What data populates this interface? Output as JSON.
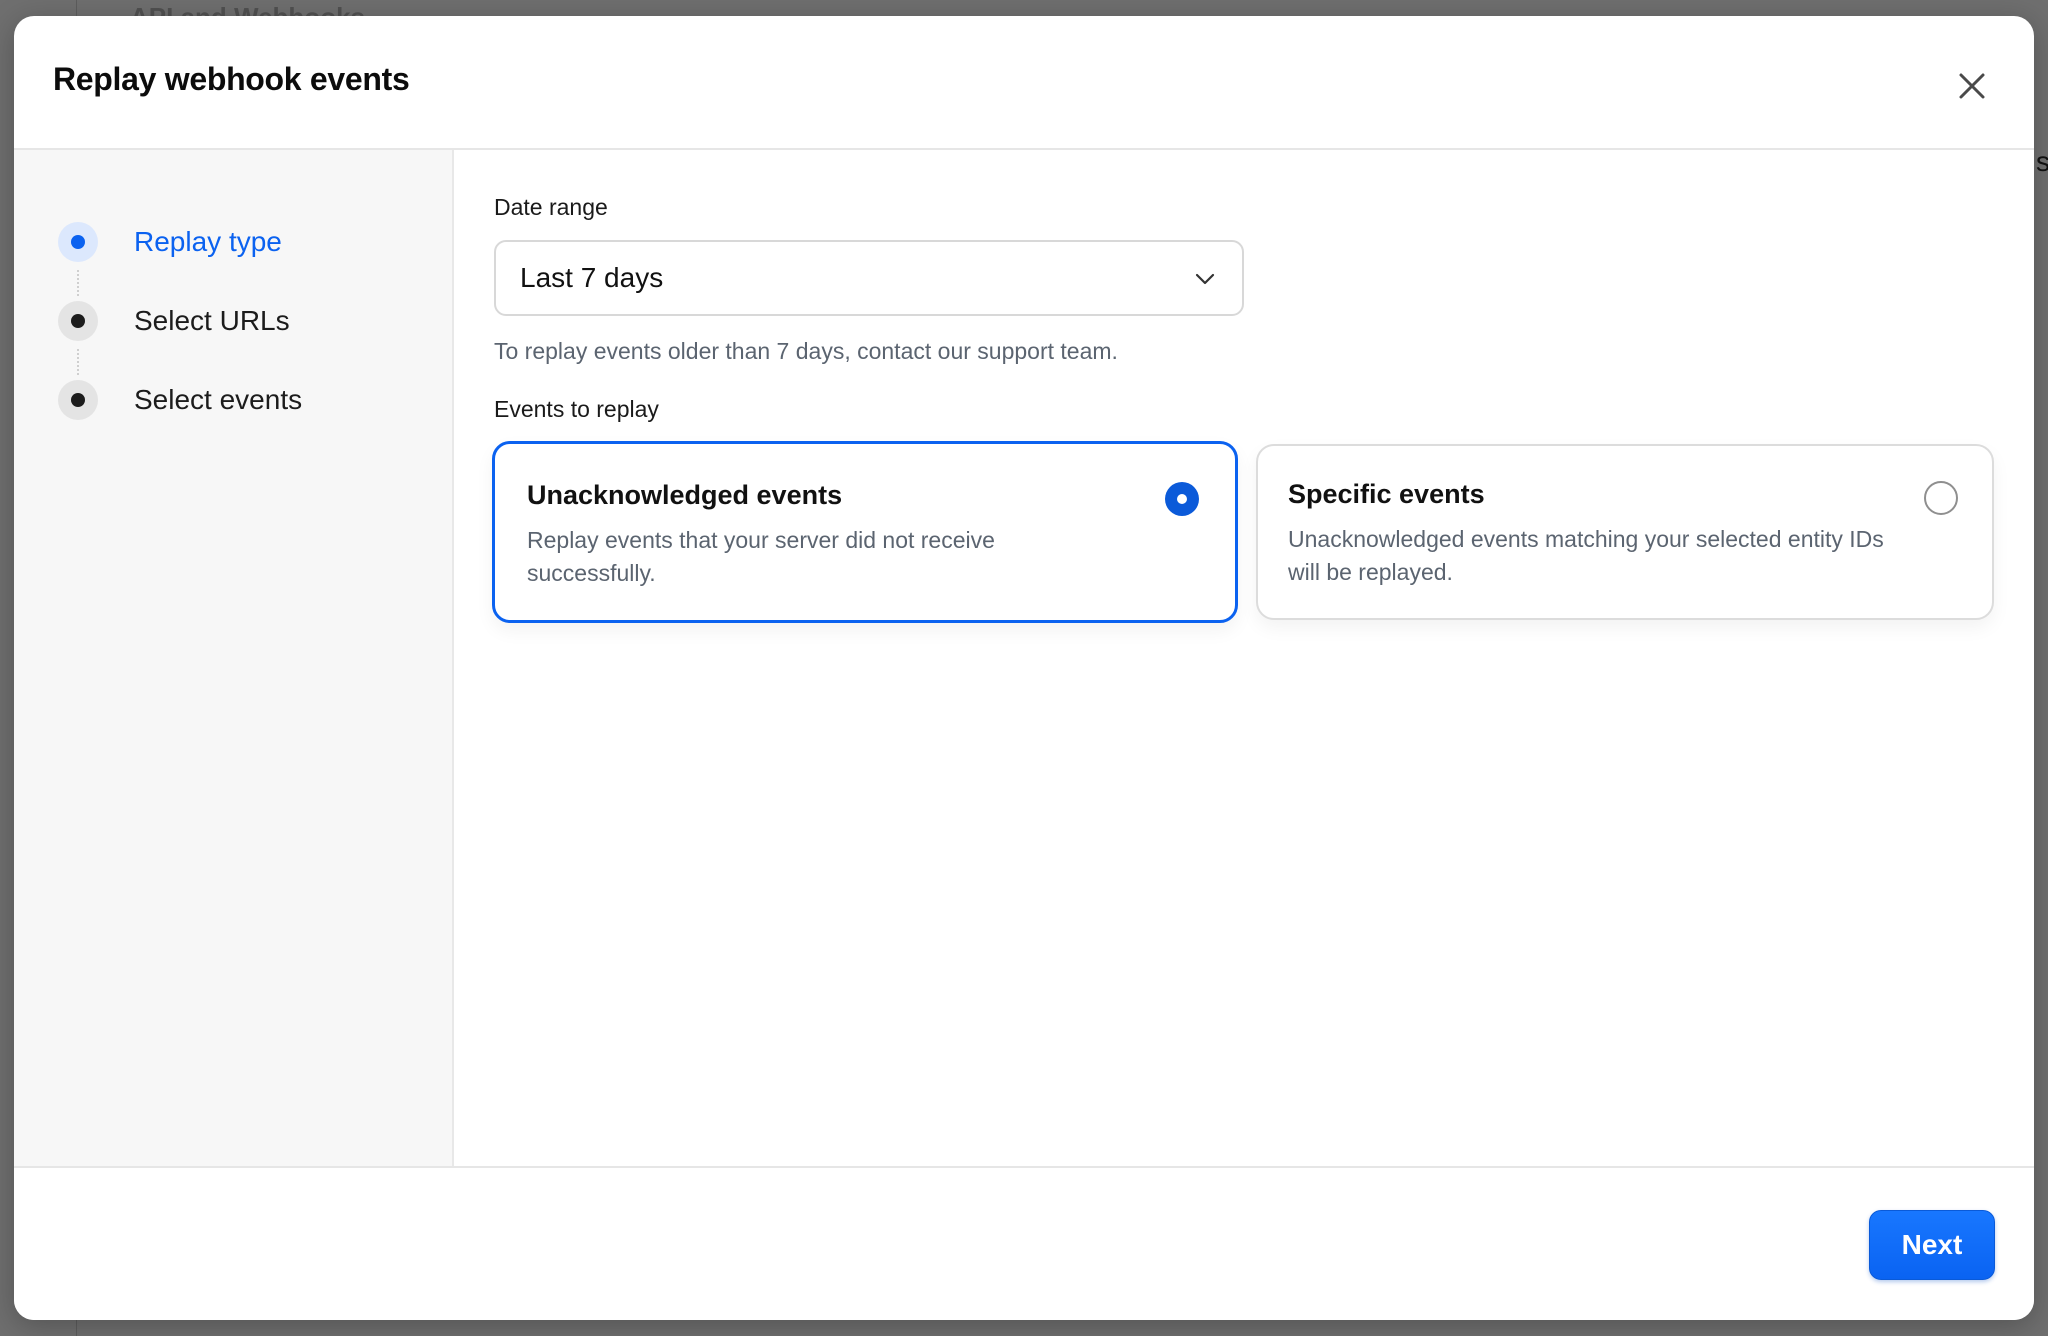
{
  "background": {
    "page_title_partial": "API and Webhooks",
    "edge_letter": "s"
  },
  "modal": {
    "title": "Replay webhook events",
    "close_icon": "close-icon"
  },
  "steps": [
    {
      "label": "Replay type",
      "state": "active"
    },
    {
      "label": "Select URLs",
      "state": "inactive"
    },
    {
      "label": "Select events",
      "state": "inactive"
    }
  ],
  "date_range": {
    "label": "Date range",
    "value": "Last 7 days",
    "help": "To replay events older than 7 days, contact our support team."
  },
  "events_to_replay": {
    "label": "Events to replay",
    "options": [
      {
        "title": "Unacknowledged events",
        "description": "Replay events that your server did not receive successfully.",
        "selected": true
      },
      {
        "title": "Specific events",
        "description": "Unacknowledged events matching your selected entity IDs will be replayed.",
        "selected": false
      }
    ]
  },
  "footer": {
    "next_label": "Next"
  },
  "colors": {
    "accent": "#0b62f0",
    "overlay": "#6f6f6f",
    "sidebar_bg": "#f7f7f7",
    "muted_text": "#5b6470"
  }
}
